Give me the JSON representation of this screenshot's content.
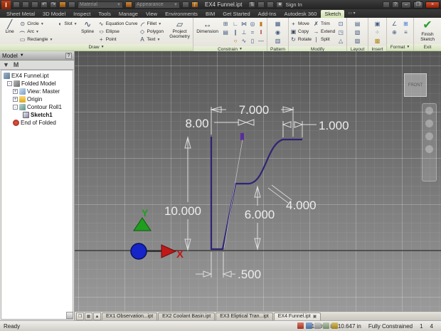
{
  "titlebar": {
    "document_title": "EX4 Funnel.ipt",
    "material_label": "Material",
    "appearance_label": "Appearance",
    "sign_in_label": "Sign In"
  },
  "ribbon_tabs": {
    "items": [
      {
        "label": "Sheet Metal"
      },
      {
        "label": "3D Model"
      },
      {
        "label": "Inspect"
      },
      {
        "label": "Tools"
      },
      {
        "label": "Manage"
      },
      {
        "label": "View"
      },
      {
        "label": "Environments"
      },
      {
        "label": "BIM"
      },
      {
        "label": "Get Started"
      },
      {
        "label": "Add-Ins"
      },
      {
        "label": "Autodesk 360"
      },
      {
        "label": "Sketch",
        "active": true
      }
    ]
  },
  "ribbon": {
    "draw": {
      "label": "Draw",
      "line": "Line",
      "circle": "Circle",
      "arc": "Arc",
      "rectangle": "Rectangle",
      "slot": "Slot",
      "spline": "Spline",
      "equation_curve": "Equation Curve",
      "ellipse": "Ellipse",
      "point": "Point",
      "fillet": "Fillet",
      "polygon": "Polygon",
      "text": "Text",
      "project_geometry": "Project Geometry"
    },
    "constrain": {
      "label": "Constrain",
      "dimension": "Dimension"
    },
    "pattern": {
      "label": "Pattern"
    },
    "modify": {
      "label": "Modify",
      "move": "Move",
      "copy": "Copy",
      "rotate": "Rotate",
      "trim": "Trim",
      "extend": "Extend",
      "split": "Split"
    },
    "layout": {
      "label": "Layout"
    },
    "insert": {
      "label": "Insert"
    },
    "format": {
      "label": "Format"
    },
    "exit": {
      "label": "Exit",
      "finish": "Finish Sketch"
    }
  },
  "browser": {
    "header": "Model",
    "tree": [
      {
        "label": "EX4 Funnel.ipt"
      },
      {
        "label": "Folded Model"
      },
      {
        "label": "View: Master"
      },
      {
        "label": "Origin"
      },
      {
        "label": "Contour Roll1"
      },
      {
        "label": "Sketch1"
      },
      {
        "label": "End of Folded"
      }
    ]
  },
  "canvas": {
    "viewcube_label": "FRONT",
    "axes": {
      "x": "X",
      "y": "Y"
    },
    "dimensions": {
      "top_width": "7.000",
      "upper_left": "8.00",
      "upper_right": "1.000",
      "overall_height": "10.000",
      "inner_height": "6.000",
      "radius": "4.000",
      "bottom_width": ".500"
    },
    "colors": {
      "sketch_line": "#2e2575",
      "dimension": "#e8e8e8"
    }
  },
  "doc_tabs": {
    "items": [
      {
        "label": "EX1 Observation...ipt"
      },
      {
        "label": "EX2 Coolant Basin.ipt"
      },
      {
        "label": "EX3 Eliptical Tran...ipt"
      },
      {
        "label": "EX4 Funnel.ipt",
        "active": true
      }
    ]
  },
  "status_bar": {
    "ready": "Ready",
    "coordinates": "19.699 in, 10.647 in",
    "constraint_status": "Fully Constrained",
    "count1": "1",
    "count2": "4"
  }
}
